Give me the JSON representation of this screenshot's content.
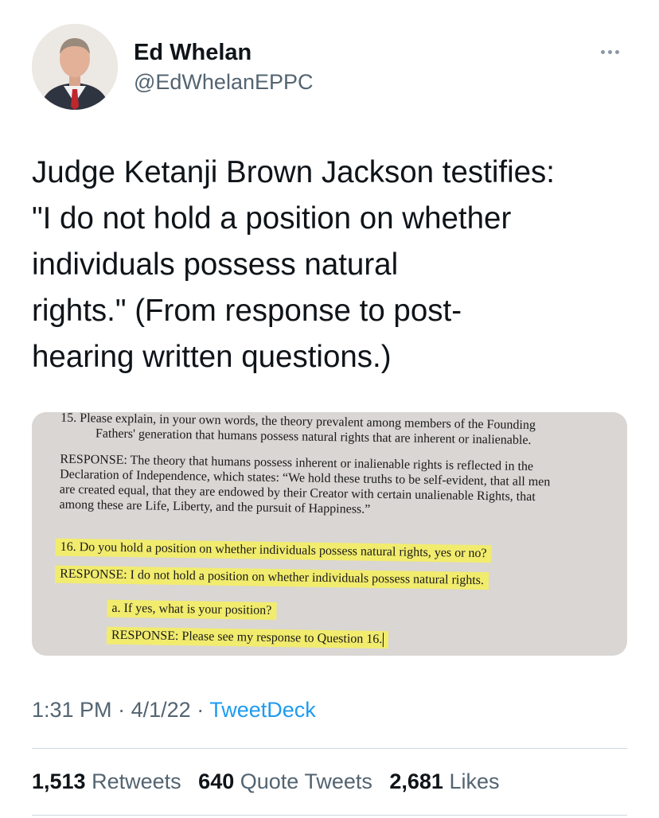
{
  "author": {
    "display_name": "Ed Whelan",
    "handle": "@EdWhelanEPPC"
  },
  "tweet": {
    "text": "Judge Ketanji Brown Jackson testifies:\n\"I do not hold a position on whether\nindividuals possess natural\nrights.\" (From response to post-\nhearing written questions.)"
  },
  "document_image": {
    "lines": [
      "15.   Please explain, in your own words, the theory prevalent among members of the Founding",
      "Fathers' generation that humans possess natural rights that are inherent or inalienable.",
      "RESPONSE: The theory that humans possess inherent or inalienable rights is reflected in the",
      "Declaration of Independence, which states: “We hold these truths to be self-evident, that all men",
      "are created equal, that they are endowed by their Creator with certain unalienable Rights, that",
      "among these are Life, Liberty, and the pursuit of Happiness.”",
      "16.   Do you hold a position on whether individuals possess natural rights, yes or no?",
      "RESPONSE: I do not hold a position on whether individuals possess natural rights.",
      "a.   If yes, what is your position?",
      "RESPONSE: Please see my response to Question 16."
    ]
  },
  "meta": {
    "time": "1:31 PM",
    "separator": "·",
    "date": "4/1/22",
    "source": "TweetDeck"
  },
  "stats": {
    "retweets_count": "1,513",
    "retweets_label": "Retweets",
    "quotes_count": "640",
    "quotes_label": "Quote Tweets",
    "likes_count": "2,681",
    "likes_label": "Likes"
  },
  "colors": {
    "text_primary": "#0f1419",
    "text_secondary": "#536471",
    "link": "#1d9bf0",
    "highlight": "#f2ec6e"
  }
}
